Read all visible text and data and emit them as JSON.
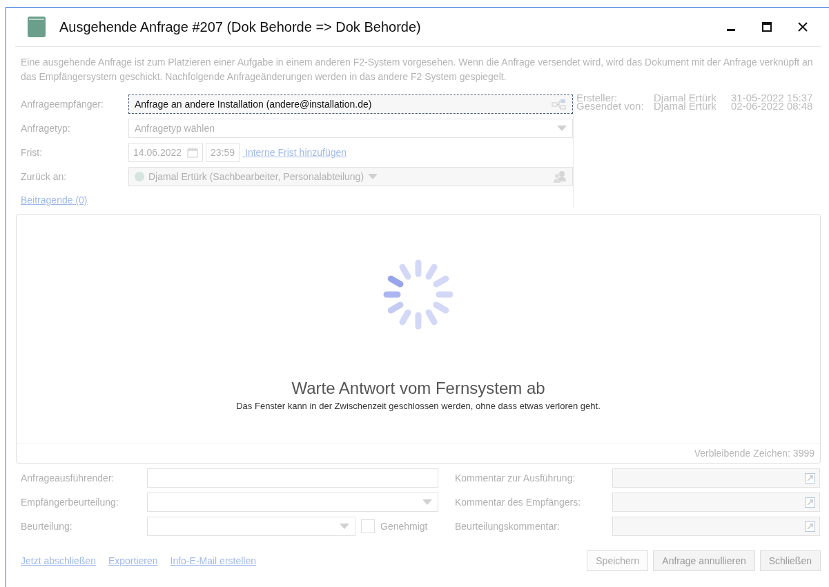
{
  "window": {
    "title": "Ausgehende Anfrage #207 (Dok Behorde => Dok Behorde)"
  },
  "description": "Eine ausgehende Anfrage ist zum Platzieren einer Aufgabe in einem anderen F2-System vorgesehen. Wenn die Anfrage versendet wird, wird das Dokument mit der Anfrage verknüpft an das Empfängersystem geschickt. Nachfolgende Anfrageänderungen werden in das andere F2 System gespiegelt.",
  "form": [
    {
      "kind": "recipient",
      "label": "Anfrageempfänger:",
      "value": "Anfrage an andere Installation (andere@installation.de)"
    },
    {
      "kind": "combo",
      "label": "Anfragetyp:",
      "placeholder": "Anfragetyp wählen"
    },
    {
      "kind": "deadline",
      "label": "Frist:",
      "date": "14.06.2022",
      "time": "23:59",
      "link": "Interne Frist hinzufügen"
    },
    {
      "kind": "person",
      "label": "Zurück an:",
      "value": "Djamal Ertürk (Sachbearbeiter, Personalabteilung)"
    }
  ],
  "contributors_link": "Beitragende (0)",
  "meta": [
    {
      "label": "Ersteller:",
      "name": "Djamal Ertürk",
      "date": "31-05-2022 15:37"
    },
    {
      "label": "Gesendet von:",
      "name": "Djamal Ertürk",
      "date": "02-06-2022 08:48"
    }
  ],
  "waiting": {
    "title": "Warte Antwort vom Fernsystem ab",
    "subtitle": "Das Fenster kann in der Zwischenzeit geschlossen werden, ohne dass etwas verloren geht.",
    "remaining": "Verbleibende Zeichen: 3999"
  },
  "bottom_left": [
    {
      "kind": "text",
      "label": "Anfrageausführender:"
    },
    {
      "kind": "combo",
      "label": "Empfängerbeurteilung:"
    },
    {
      "kind": "combo_check",
      "label": "Beurteilung:",
      "check_label": "Genehmigt",
      "checked": false
    }
  ],
  "bottom_right": [
    {
      "label": "Kommentar zur Ausführung:"
    },
    {
      "label": "Kommentar des Empfängers:"
    },
    {
      "label": "Beurteilungskommentar:"
    }
  ],
  "links": [
    "Jetzt abschließen",
    "Exportieren",
    "Info-E-Mail erstellen"
  ],
  "buttons": [
    {
      "label": "Speichern",
      "disabled": true
    },
    {
      "label": "Anfrage annullieren",
      "disabled": false
    },
    {
      "label": "Schließen",
      "disabled": false
    }
  ]
}
